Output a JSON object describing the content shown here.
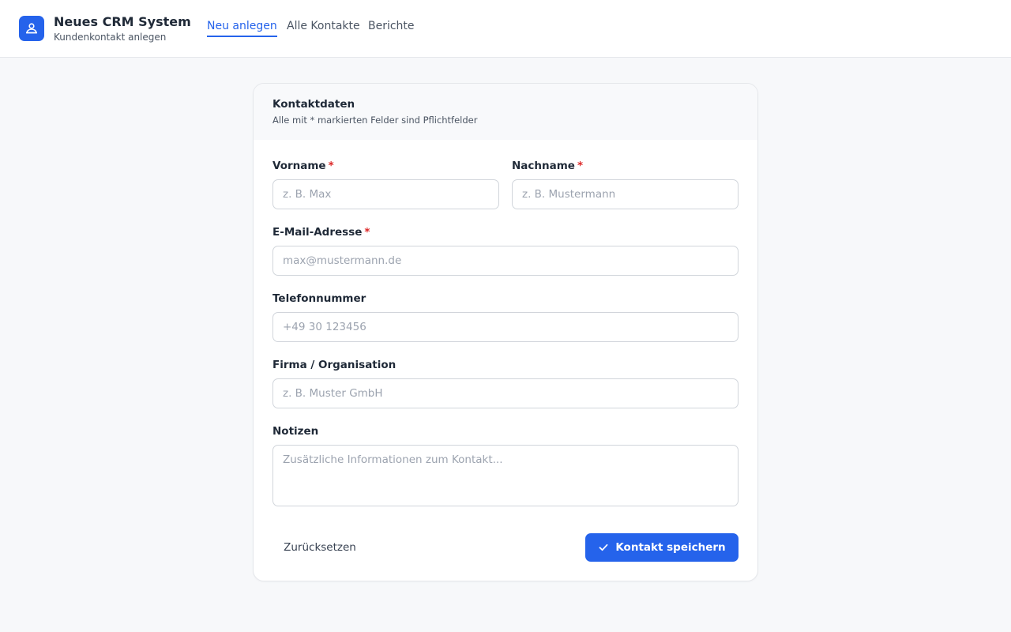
{
  "app": {
    "title": "Neues CRM System",
    "subtitle": "Kundenkontakt anlegen",
    "logo_icon": "user-group-icon",
    "accent_color": "#2563eb"
  },
  "nav": {
    "tabs": [
      {
        "label": "Neu anlegen",
        "active": true
      },
      {
        "label": "Alle Kontakte",
        "active": false
      },
      {
        "label": "Berichte",
        "active": false
      }
    ]
  },
  "form": {
    "title": "Kontaktdaten",
    "subtitle": "Alle mit * markierten Felder sind Pflichtfelder",
    "required_marker": "*",
    "fields": {
      "first_name": {
        "label": "Vorname",
        "placeholder": "z. B. Max",
        "value": "",
        "required": true
      },
      "last_name": {
        "label": "Nachname",
        "placeholder": "z. B. Mustermann",
        "value": "",
        "required": true
      },
      "email": {
        "label": "E-Mail-Adresse",
        "placeholder": "max@mustermann.de",
        "value": "",
        "required": true
      },
      "phone": {
        "label": "Telefonnummer",
        "placeholder": "+49 30 123456",
        "value": "",
        "required": false
      },
      "company": {
        "label": "Firma / Organisation",
        "placeholder": "z. B. Muster GmbH",
        "value": "",
        "required": false
      },
      "notes": {
        "label": "Notizen",
        "placeholder": "Zusätzliche Informationen zum Kontakt...",
        "value": "",
        "required": false
      }
    },
    "reset_label": "Zurücksetzen",
    "save_label": "Kontakt speichern",
    "save_icon": "checkmark-icon"
  }
}
